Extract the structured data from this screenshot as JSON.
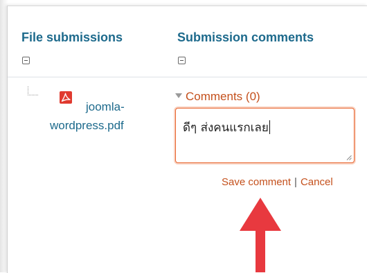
{
  "columns": [
    {
      "header": "File submissions",
      "collapse_icon": "collapse-minus-icon"
    },
    {
      "header": "Submission comments",
      "collapse_icon": "collapse-minus-icon"
    }
  ],
  "submission": {
    "file_icon": "pdf-icon",
    "file_name_line1": "joomla-",
    "file_name_line2": "wordpress.pdf"
  },
  "comments": {
    "toggle_label": "Comments (0)",
    "input_value": "ดีๆ ส่งคนแรกเลย",
    "save_label": "Save comment",
    "separator": "|",
    "cancel_label": "Cancel"
  },
  "annotation": {
    "arrow_icon": "red-up-arrow",
    "color": "#e8393f"
  },
  "colors": {
    "link_blue": "#1d6a8c",
    "accent_orange": "#c4501c",
    "focus_border": "#e8632c"
  }
}
